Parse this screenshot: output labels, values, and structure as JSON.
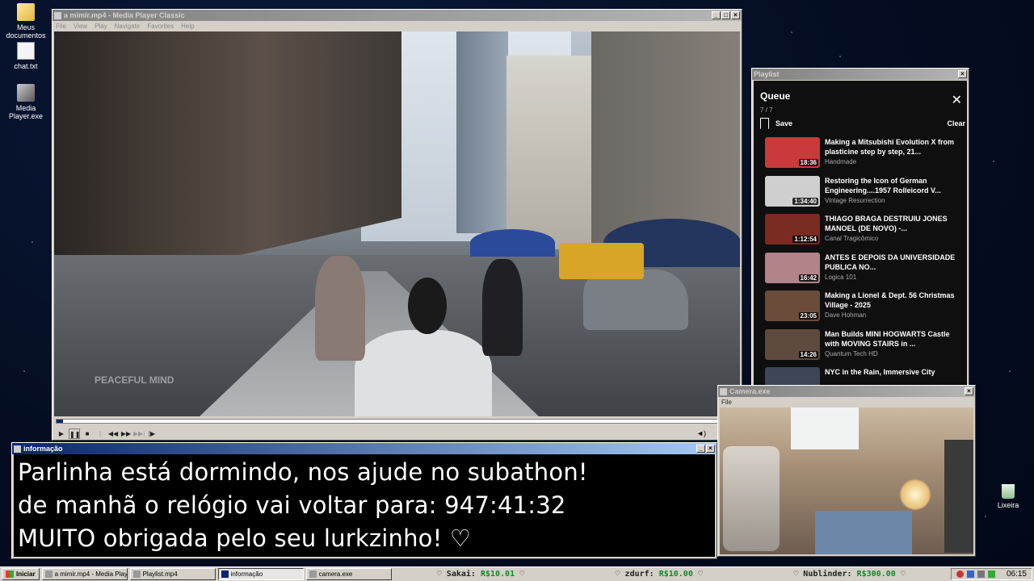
{
  "desktop": {
    "icons": [
      {
        "label": "Meus documentos",
        "icon": "folder-icon"
      },
      {
        "label": "chat.txt",
        "icon": "text-file-icon"
      },
      {
        "label": "Media Player.exe",
        "icon": "media-player-icon"
      }
    ],
    "recycle_bin": "Lixeira"
  },
  "player": {
    "title": "a mimir.mp4 - Media Player Classic",
    "menu": [
      "File",
      "View",
      "Play",
      "Navigate",
      "Favorites",
      "Help"
    ],
    "watermark": "PEACEFUL MIND",
    "progress_fraction": 0.01
  },
  "playlist": {
    "window_title": "Playlist",
    "heading": "Queue",
    "count": "7 / 7",
    "save_label": "Save",
    "clear_label": "Clear",
    "items": [
      {
        "title": "Making a Mitsubishi Evolution X from plasticine step by step, 21...",
        "channel": "Handmade",
        "duration": "18:36",
        "color": "#c93a3a"
      },
      {
        "title": "Restoring the Icon of German Engineering....1957 Rolleicord V...",
        "channel": "Vintage Resurrection",
        "duration": "1:34:40",
        "color": "#cfcfcf"
      },
      {
        "title": "THIAGO BRAGA DESTRUIU JONES MANOEL (DE NOVO) -...",
        "channel": "Canal Tragicômico",
        "duration": "1:12:54",
        "color": "#7a2b22"
      },
      {
        "title": "ANTES E DEPOIS DA UNIVERSIDADE PUBLICA NO...",
        "channel": "Logica 101",
        "duration": "16:42",
        "color": "#b3838a"
      },
      {
        "title": "Making a Lionel & Dept. 56 Christmas Village - 2025",
        "channel": "Dave Hohman",
        "duration": "23:05",
        "color": "#6b4b3a"
      },
      {
        "title": "Man Builds MINI HOGWARTS Castle with MOVING STAIRS in ...",
        "channel": "Quantum Tech HD",
        "duration": "14:26",
        "color": "#5e4a3e"
      },
      {
        "title": "NYC in the Rain, Immersive City",
        "channel": "",
        "duration": "",
        "color": "#3c4654"
      }
    ]
  },
  "camera": {
    "title": "Camera.exe",
    "menu": "File"
  },
  "info": {
    "title": "informação",
    "lines": [
      "Parlinha está dormindo, nos ajude no subathon!",
      "de manhã o relógio vai voltar para:  947:41:32",
      "MUITO obrigada pelo seu lurkzinho! ♡"
    ]
  },
  "taskbar": {
    "start": "Iniciar",
    "tasks": [
      "a mimir.mp4 - Media Playe...",
      "Playlist.mp4",
      "informação",
      "camera.exe"
    ],
    "donations": [
      {
        "name": "Sakai:",
        "amount": "R$10.01"
      },
      {
        "name": "zdurf:",
        "amount": "R$10.00"
      },
      {
        "name": "Nublinder:",
        "amount": "R$300.00"
      }
    ],
    "clock": "06:15"
  },
  "colors": {
    "titlebar_active": "#0a246a",
    "window_face": "#d4d0c8",
    "donation_amount": "#118a26"
  }
}
